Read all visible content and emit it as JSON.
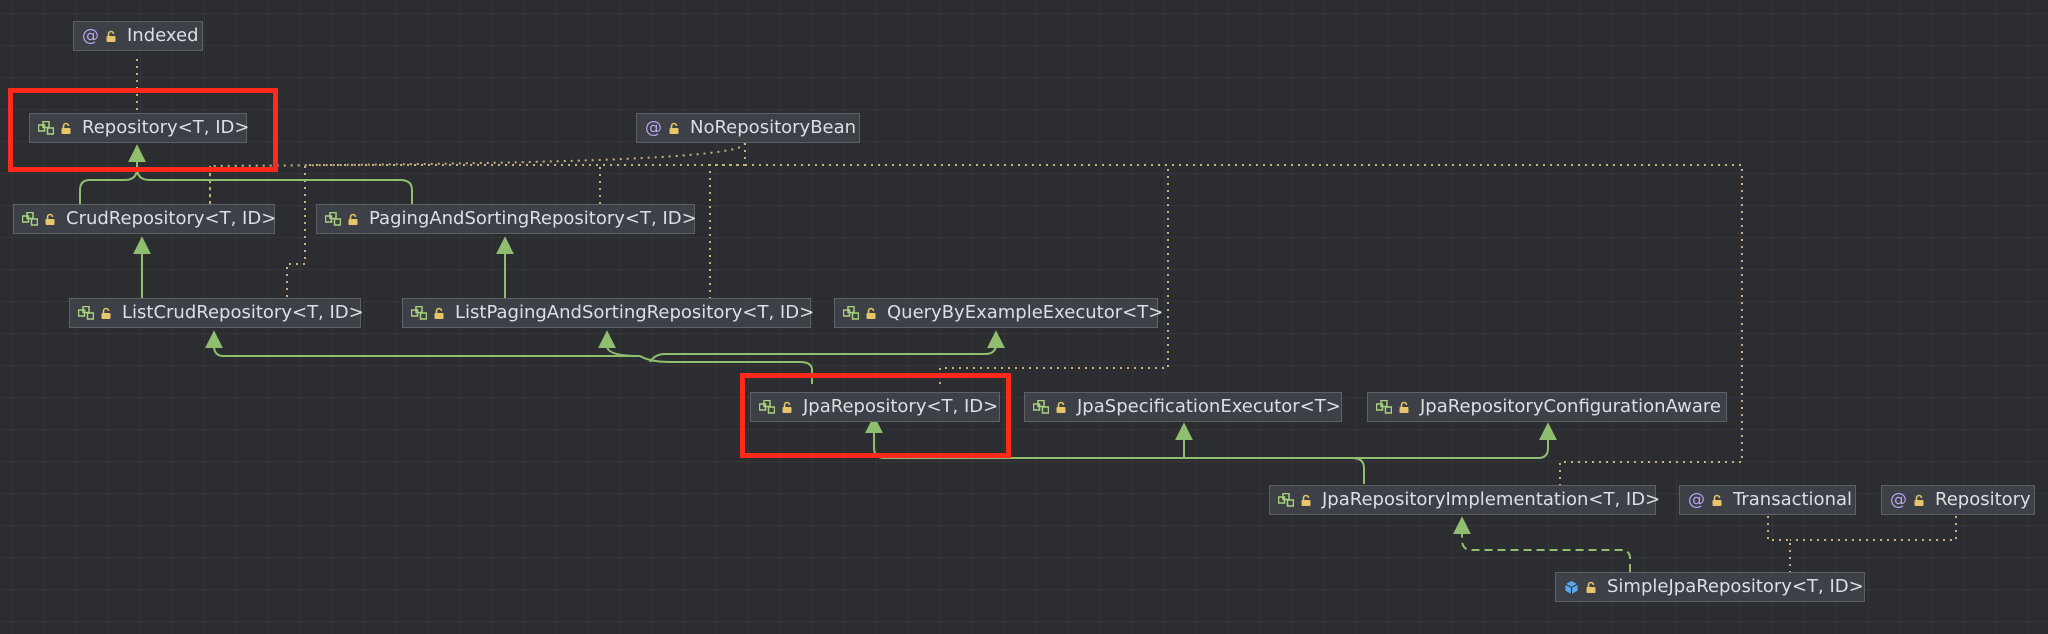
{
  "nodes": {
    "indexed": {
      "label": "Indexed",
      "kind": "annotation"
    },
    "repository": {
      "label": "Repository<T, ID>",
      "kind": "interface"
    },
    "noRepositoryBean": {
      "label": "NoRepositoryBean",
      "kind": "annotation"
    },
    "crudRepository": {
      "label": "CrudRepository<T, ID>",
      "kind": "interface"
    },
    "pagingAndSortingRepository": {
      "label": "PagingAndSortingRepository<T, ID>",
      "kind": "interface"
    },
    "listCrudRepository": {
      "label": "ListCrudRepository<T, ID>",
      "kind": "interface"
    },
    "listPagingAndSortingRepository": {
      "label": "ListPagingAndSortingRepository<T, ID>",
      "kind": "interface"
    },
    "queryByExampleExecutor": {
      "label": "QueryByExampleExecutor<T>",
      "kind": "interface"
    },
    "jpaRepository": {
      "label": "JpaRepository<T, ID>",
      "kind": "interface"
    },
    "jpaSpecificationExecutor": {
      "label": "JpaSpecificationExecutor<T>",
      "kind": "interface"
    },
    "jpaRepositoryConfigurationAware": {
      "label": "JpaRepositoryConfigurationAware",
      "kind": "interface"
    },
    "jpaRepositoryImplementation": {
      "label": "JpaRepositoryImplementation<T, ID>",
      "kind": "interface"
    },
    "transactional": {
      "label": "Transactional",
      "kind": "annotation"
    },
    "repositoryAnnotation": {
      "label": "Repository",
      "kind": "annotation"
    },
    "simpleJpaRepository": {
      "label": "SimpleJpaRepository<T, ID>",
      "kind": "class"
    }
  },
  "colors": {
    "background": "#2b2d30",
    "node_fill": "#3d4046",
    "node_border": "#5d6166",
    "text": "#dcdfe4",
    "extends_edge": "#8fbf6e",
    "annotation_edge": "#e0c98a",
    "highlight": "#ff2a1c",
    "annotation_icon": "#b9a4f0",
    "interface_icon": "#a8d37f",
    "class_icon": "#5aa9e6",
    "lock_icon": "#e8c46a"
  },
  "highlighted": [
    "repository",
    "jpaRepository"
  ]
}
